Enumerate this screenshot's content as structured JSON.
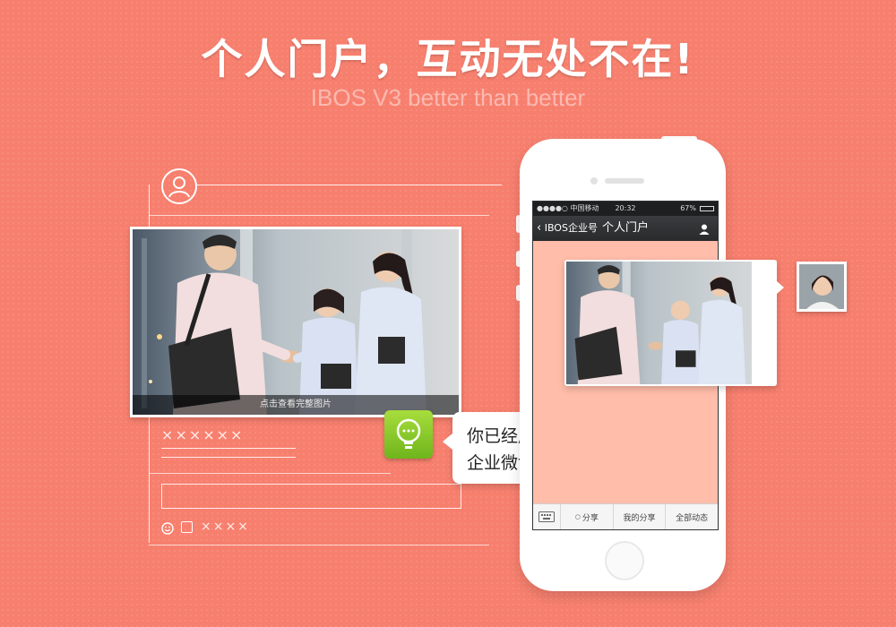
{
  "promo": {
    "headline": "个人门户，互动无处不在!",
    "tagline": "IBOS V3 better than better"
  },
  "left_mockup": {
    "photo_caption": "点击查看完整图片",
    "name_placeholder": "××××××",
    "footer_placeholder": "××××"
  },
  "notification": {
    "line1": "你已经成功发送该消息到",
    "line2": "企业微博"
  },
  "phone": {
    "status_bar": {
      "carrier": "●●●●○ 中国移动",
      "time": "20:32",
      "battery": "67%"
    },
    "nav": {
      "back_label": "IBOS企业号",
      "title": "个人门户"
    },
    "bottom_menu": {
      "items": [
        {
          "label": "分享"
        },
        {
          "label": "我的分享"
        },
        {
          "label": "全部动态"
        }
      ]
    }
  },
  "colors": {
    "background": "#f77f6e",
    "chat_background": "#ffbdaa",
    "bulb_green": "#8ccb2a"
  }
}
